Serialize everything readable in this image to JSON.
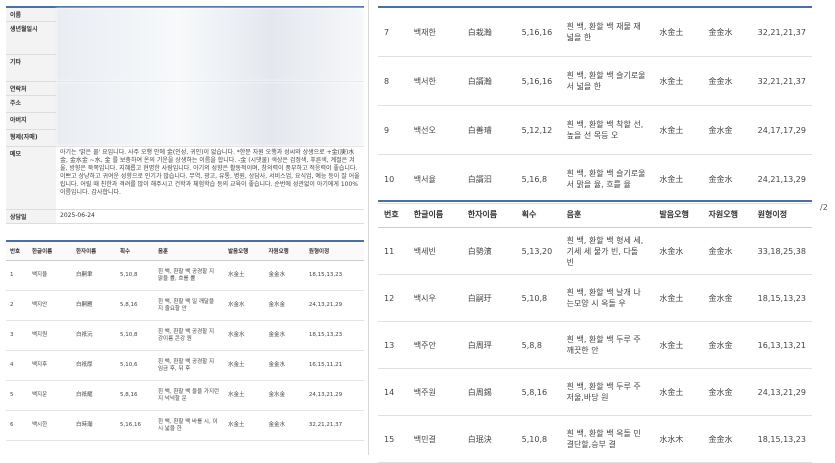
{
  "info": {
    "labels": {
      "name": "이름",
      "birth": "생년월일시",
      "etc": "기타",
      "contact": "연락처",
      "address": "주소",
      "father": "아버지",
      "siblings": "형제(자매)",
      "memo": "메모",
      "date": "상담일"
    },
    "memo": "아기는 '맑은 물' 요입니다. 사주 오행 안에 金(인성, 귀인)이 없습니다. *한문 자원 오행과 성씨와 상생으로 +金(庚)水金, 金水金 ~水, 金 를 보충하여 온의 기운을 상생하는 이름을 합니다. -金 (시댓물) 색상은 검정색, 푸른색, 계절은 겨울, 방향은 북쪽입니다. 지혜롭고 현명한 사람입니다. 아기의 성향은 활동적이며, 창의력이 풍부하고 적응력이 좋습니다. 이쁘고 상냥하고 귀여운 성향으로 인기가 많습니다. 무역, 광고, 유통, 병원, 상담사, 서비스업, 요식업, 예능 등이 잘 어울립니다. 어릴 때 친한과 격려를 많이 해주시고 건학과 체험학습 등의 교육이 좋습니다. 순번에 성관없이 아기에게 100% 이름입니다. 감사합니다.",
    "date": "2025-06-24"
  },
  "headers": {
    "no": "번호",
    "kor": "한글이름",
    "han": "한자이름",
    "strokes": "획수",
    "meaning": "음훈",
    "sound": "발음오행",
    "source": "자원오행",
    "original": "원형이정"
  },
  "small_rows": [
    {
      "no": "1",
      "kor": "백지율",
      "han": "白嗣聿",
      "strokes": "5,10,8",
      "meaning": "흰 백, 환할 백 공경할 지 맑을 률, 흐를 률",
      "sound": "水金土",
      "source": "金金水",
      "original": "18,15,13,23"
    },
    {
      "no": "2",
      "kor": "백지안",
      "han": "白嗣雁",
      "strokes": "5,8,16",
      "meaning": "흰 백, 환할 백 일 깨달을 지 줄요할 안",
      "sound": "水金水",
      "source": "金水金",
      "original": "24,13,21,29"
    },
    {
      "no": "3",
      "kor": "백지원",
      "han": "白祇沅",
      "strokes": "5,10,8",
      "meaning": "흰 백, 환할 백 공경할 지 강이름 콘강 원",
      "sound": "水金水",
      "source": "金金水",
      "original": "18,15,13,23"
    },
    {
      "no": "4",
      "kor": "백지후",
      "han": "白祇厚",
      "strokes": "5,10,6",
      "meaning": "흰 백, 환할 백 공경할 지 임금 후, 뒤 후",
      "sound": "水金土",
      "source": "金金水",
      "original": "16,15,11,21"
    },
    {
      "no": "5",
      "kor": "백지운",
      "han": "白祇耀",
      "strokes": "5,8,16",
      "meaning": "흰 백, 환할 백 울을 가지런 지 넉넉할 운",
      "sound": "水金土",
      "source": "金水金",
      "original": "24,13,21,29"
    },
    {
      "no": "6",
      "kor": "백시한",
      "han": "白時瀚",
      "strokes": "5,16,16",
      "meaning": "흰 백, 환할 백 바를 시, 이 시 넓을 한",
      "sound": "水金土",
      "source": "金金水",
      "original": "32,21,21,37"
    }
  ],
  "big_rows_top": [
    {
      "no": "7",
      "kor": "백재한",
      "han": "白栽瀚",
      "strokes": "5,16,16",
      "meaning": "흰 백, 환할 백 재물 재 넓을 한",
      "sound": "水金土",
      "source": "金金水",
      "original": "32,21,21,37"
    },
    {
      "no": "8",
      "kor": "백서한",
      "han": "白諝瀚",
      "strokes": "5,16,16",
      "meaning": "흰 백, 환할 백 슬기로울 서 넓을 한",
      "sound": "水金土",
      "source": "金金水",
      "original": "32,21,21,37"
    },
    {
      "no": "9",
      "kor": "백선오",
      "han": "白善璿",
      "strokes": "5,12,12",
      "meaning": "흰 백, 환할 백 착할 선, 높을 선 목등 오",
      "sound": "水金土",
      "source": "金水金",
      "original": "24,17,17,29"
    },
    {
      "no": "10",
      "kor": "백서율",
      "han": "白諝汩",
      "strokes": "5,16,8",
      "meaning": "흰 백, 환할 백 슬기로울 서 맑을 율, 흐를 율",
      "sound": "水金土",
      "source": "金金水",
      "original": "24,21,13,29"
    }
  ],
  "big_rows_bottom": [
    {
      "no": "11",
      "kor": "백세빈",
      "han": "白勢濱",
      "strokes": "5,13,20",
      "meaning": "흰 백, 환할 백 형세 세, 기세 세 물가 빈, 다돌 빈",
      "sound": "水金水",
      "source": "金金水",
      "original": "33,18,25,38"
    },
    {
      "no": "12",
      "kor": "백시우",
      "han": "白嗣玗",
      "strokes": "5,10,8",
      "meaning": "흰 백, 환할 백 날개 나는모양 시 옥돌 우",
      "sound": "水金土",
      "source": "金水金",
      "original": "18,15,13,23"
    },
    {
      "no": "13",
      "kor": "백주안",
      "han": "白周玶",
      "strokes": "5,8,8",
      "meaning": "흰 백, 환할 백 두루 주 깨끗한 안",
      "sound": "水金土",
      "source": "金水金",
      "original": "16,13,13,21"
    },
    {
      "no": "14",
      "kor": "백주원",
      "han": "白周錫",
      "strokes": "5,8,16",
      "meaning": "흰 백, 환할 백 두루 주 저울,바당 원",
      "sound": "水金土",
      "source": "金水金",
      "original": "24,13,21,29"
    },
    {
      "no": "15",
      "kor": "백민결",
      "han": "白珉決",
      "strokes": "5,10,8",
      "meaning": "흰 백, 환할 백 옥돌 민 결단할,승부 결",
      "sound": "水水木",
      "source": "金金水",
      "original": "18,15,13,23"
    }
  ],
  "tail_mark": "/2"
}
